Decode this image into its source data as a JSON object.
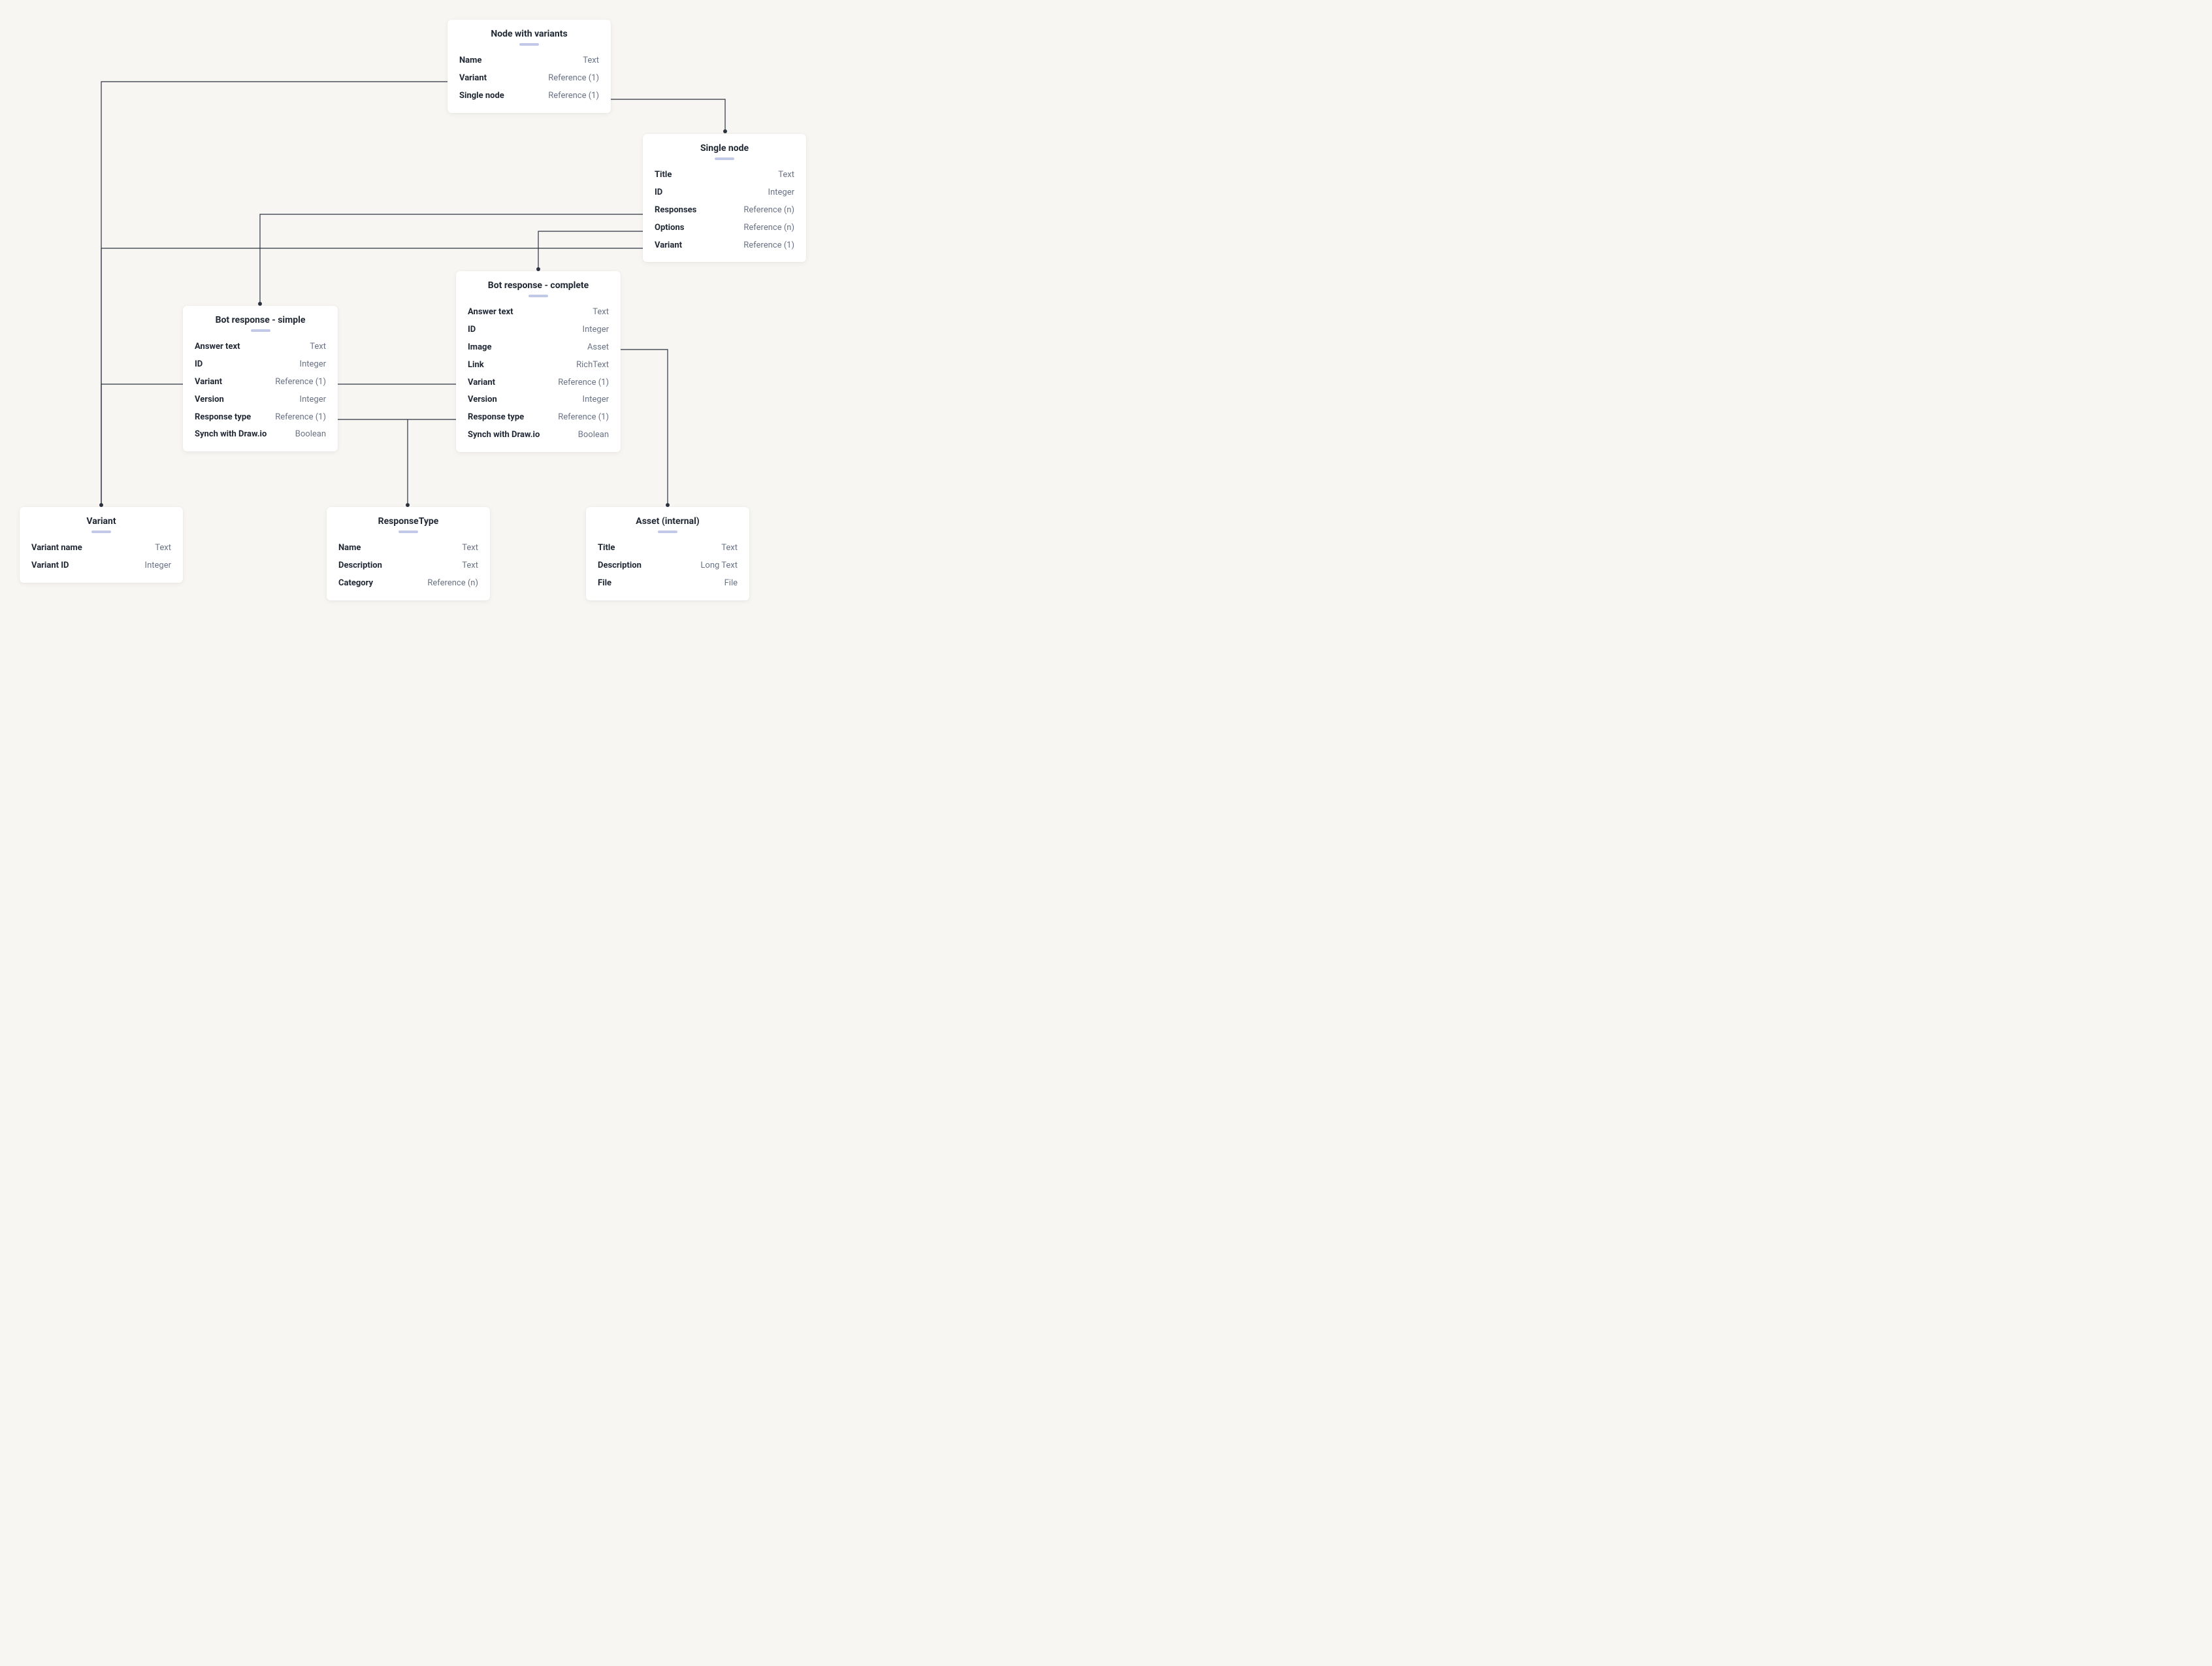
{
  "nodes": {
    "nodeVariants": {
      "title": "Node with variants",
      "fields": [
        {
          "k": "Name",
          "v": "Text"
        },
        {
          "k": "Variant",
          "v": "Reference (1)"
        },
        {
          "k": "Single node",
          "v": "Reference (1)"
        }
      ]
    },
    "singleNode": {
      "title": "Single node",
      "fields": [
        {
          "k": "Title",
          "v": "Text"
        },
        {
          "k": "ID",
          "v": "Integer"
        },
        {
          "k": "Responses",
          "v": "Reference (n)"
        },
        {
          "k": "Options",
          "v": "Reference (n)"
        },
        {
          "k": "Variant",
          "v": "Reference (1)"
        }
      ]
    },
    "botSimple": {
      "title": "Bot response - simple",
      "fields": [
        {
          "k": "Answer text",
          "v": "Text"
        },
        {
          "k": "ID",
          "v": "Integer"
        },
        {
          "k": "Variant",
          "v": "Reference (1)"
        },
        {
          "k": "Version",
          "v": "Integer"
        },
        {
          "k": "Response type",
          "v": "Reference (1)"
        },
        {
          "k": "Synch with Draw.io",
          "v": "Boolean"
        }
      ]
    },
    "botComplete": {
      "title": "Bot response - complete",
      "fields": [
        {
          "k": "Answer text",
          "v": "Text"
        },
        {
          "k": "ID",
          "v": "Integer"
        },
        {
          "k": "Image",
          "v": "Asset"
        },
        {
          "k": "Link",
          "v": "RichText"
        },
        {
          "k": "Variant",
          "v": "Reference (1)"
        },
        {
          "k": "Version",
          "v": "Integer"
        },
        {
          "k": "Response type",
          "v": "Reference (1)"
        },
        {
          "k": "Synch with Draw.io",
          "v": "Boolean"
        }
      ]
    },
    "variant": {
      "title": "Variant",
      "fields": [
        {
          "k": "Variant name",
          "v": "Text"
        },
        {
          "k": "Variant ID",
          "v": "Integer"
        }
      ]
    },
    "responseType": {
      "title": "ResponseType",
      "fields": [
        {
          "k": "Name",
          "v": "Text"
        },
        {
          "k": "Description",
          "v": "Text"
        },
        {
          "k": "Category",
          "v": "Reference (n)"
        }
      ]
    },
    "asset": {
      "title": "Asset (internal)",
      "fields": [
        {
          "k": "Title",
          "v": "Text"
        },
        {
          "k": "Description",
          "v": "Long Text"
        },
        {
          "k": "File",
          "v": "File"
        }
      ]
    }
  }
}
